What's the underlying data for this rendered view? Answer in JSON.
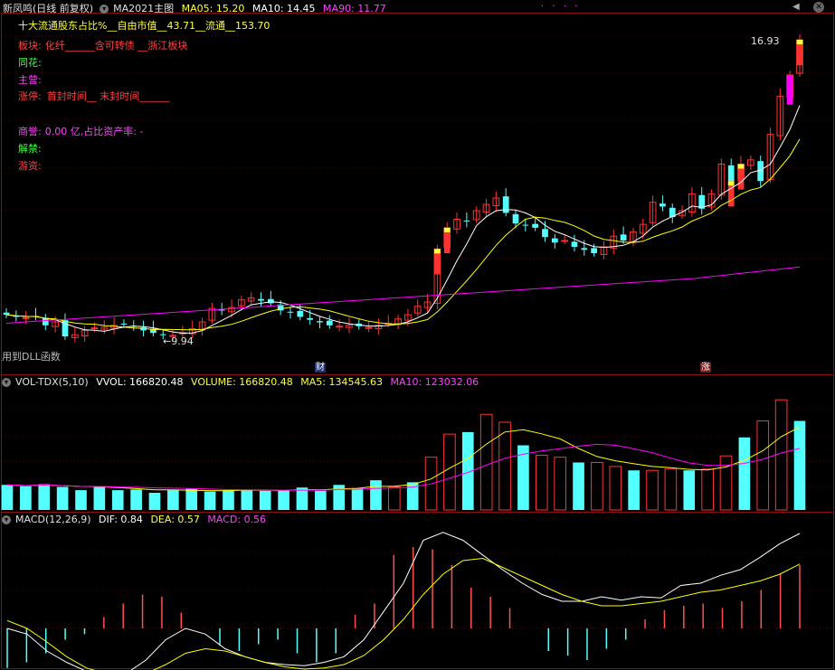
{
  "header": {
    "title": "新凤鸣(日线 前复权)",
    "indicator_name": "MA2021主图",
    "ma05_label": "MA05: 15.20",
    "ma10_label": "MA10: 14.45",
    "ma90_label": "MA90: 11.77",
    "dots": "· · · ·",
    "prev_icon": "prev-icon",
    "close_icon": "close-icon"
  },
  "info": {
    "line1": "十大流通股东占比%__自由市值__43.71__流通__153.70",
    "board_label": "板块:",
    "board_value": "化纤______含可转债 __浙江板块",
    "tonghua_label": "同花:",
    "zhuying_label": "主营:",
    "zhangting_label": "涨停:",
    "zhangting_value": "首封时间__ 末封时间______",
    "shangyu_label": "商誉:",
    "shangyu_value": "0.00 亿,占比资产率: -",
    "jiejin_label": "解禁:",
    "youzi_label": "游资:"
  },
  "main_chart": {
    "high_label": "16.93",
    "low_label": "←9.94",
    "dll_text": "用到DLL函数",
    "marker_cai": "财",
    "marker_zhang": "涨"
  },
  "volume": {
    "name": "VOL-TDX(5,10)",
    "vvol_label": "VVOL: 166820.48",
    "volume_label": "VOLUME: 166820.48",
    "ma5_label": "MA5: 134545.63",
    "ma10_label": "MA10: 123032.06"
  },
  "macd": {
    "name": "MACD(12,26,9)",
    "dif_label": "DIF: 0.84",
    "dea_label": "DEA: 0.57",
    "macd_label": "MACD: 0.56"
  },
  "colors": {
    "up": "#ff3232",
    "down": "#54ffff",
    "ma5": "#ffffff",
    "ma10": "#ffff00",
    "ma90": "#ff00ff",
    "macd_up": "#ff5050",
    "macd_down": "#54ffff",
    "label_red": "#ff4040",
    "label_magenta": "#ff40ff",
    "label_green": "#40ff40",
    "label_yellow": "#ffff40"
  },
  "chart_data": [
    {
      "type": "candlestick",
      "title": "新凤鸣(日线 前复权)",
      "close": [
        10.45,
        10.4,
        10.38,
        10.4,
        10.2,
        10.28,
        9.94,
        9.98,
        10.08,
        10.14,
        10.16,
        10.2,
        10.22,
        10.18,
        10.08,
        10.02,
        9.98,
        9.96,
        10.03,
        10.12,
        10.28,
        10.6,
        10.55,
        10.62,
        10.8,
        10.85,
        10.78,
        10.72,
        10.55,
        10.5,
        10.4,
        10.33,
        10.27,
        10.2,
        10.18,
        10.2,
        10.18,
        10.15,
        10.2,
        10.25,
        10.35,
        10.45,
        10.65,
        10.75,
        12.0,
        12.5,
        12.7,
        12.65,
        12.9,
        13.05,
        13.2,
        12.85,
        12.6,
        12.55,
        12.5,
        12.28,
        12.15,
        12.2,
        12.05,
        11.98,
        11.9,
        12.05,
        12.3,
        12.2,
        12.4,
        12.58,
        13.1,
        13.0,
        12.75,
        12.9,
        13.3,
        12.95,
        13.3,
        14.0,
        13.6,
        14.0,
        14.1,
        13.6,
        14.7,
        15.6,
        16.1,
        16.93
      ],
      "ma_series": [
        "MA05",
        "MA10",
        "MA90"
      ],
      "annotations": [
        "16.93",
        "←9.94",
        "财",
        "涨"
      ]
    },
    {
      "type": "bar",
      "title": "VOL-TDX(5,10)",
      "series": [
        {
          "name": "VOLUME",
          "values": [
            0.38,
            0.36,
            0.39,
            0.35,
            0.3,
            0.36,
            0.3,
            0.31,
            0.26,
            0.3,
            0.32,
            0.28,
            0.3,
            0.31,
            0.29,
            0.3,
            0.34,
            0.29,
            0.38,
            0.33,
            0.45,
            0.35,
            0.42,
            0.8,
            1.15,
            1.18,
            1.45,
            1.33,
            0.98,
            0.83,
            0.8,
            0.72,
            0.72,
            0.66,
            0.6,
            0.6,
            0.62,
            0.6,
            0.62,
            0.82,
            1.1,
            1.35,
            1.67,
            1.35
          ]
        }
      ]
    },
    {
      "type": "bar",
      "title": "MACD(12,26,9)",
      "series": [
        {
          "name": "MACD",
          "values": [
            -0.35,
            -0.3,
            -0.22,
            -0.1,
            -0.05,
            0.1,
            0.22,
            0.3,
            0.28,
            0.14,
            0.0,
            -0.15,
            -0.2,
            -0.14,
            -0.1,
            -0.22,
            -0.3,
            -0.22,
            0.12,
            0.22,
            0.65,
            0.72,
            0.7,
            0.56,
            0.36,
            0.28,
            0.18,
            0.0,
            -0.2,
            -0.24,
            -0.28,
            -0.18,
            -0.1,
            0.08,
            0.16,
            0.2,
            0.22,
            0.18,
            0.24,
            0.34,
            0.48,
            0.56
          ]
        },
        {
          "name": "DIF",
          "values": [
            0.0,
            -0.05,
            -0.2,
            -0.3,
            -0.38,
            -0.42,
            -0.4,
            -0.28,
            -0.1,
            0.0,
            -0.05,
            -0.18,
            -0.25,
            -0.3,
            -0.32,
            -0.33,
            -0.3,
            -0.25,
            -0.1,
            0.15,
            0.4,
            0.78,
            0.85,
            0.78,
            0.65,
            0.52,
            0.4,
            0.3,
            0.24,
            0.24,
            0.28,
            0.25,
            0.28,
            0.27,
            0.38,
            0.4,
            0.47,
            0.52,
            0.63,
            0.75,
            0.84
          ]
        },
        {
          "name": "DEA",
          "values": [
            0.07,
            0.0,
            -0.12,
            -0.25,
            -0.35,
            -0.4,
            -0.42,
            -0.4,
            -0.32,
            -0.22,
            -0.18,
            -0.2,
            -0.25,
            -0.3,
            -0.34,
            -0.36,
            -0.35,
            -0.32,
            -0.24,
            -0.1,
            0.08,
            0.3,
            0.48,
            0.6,
            0.62,
            0.54,
            0.46,
            0.38,
            0.3,
            0.24,
            0.2,
            0.2,
            0.22,
            0.24,
            0.28,
            0.32,
            0.34,
            0.38,
            0.42,
            0.48,
            0.57
          ]
        }
      ]
    }
  ]
}
